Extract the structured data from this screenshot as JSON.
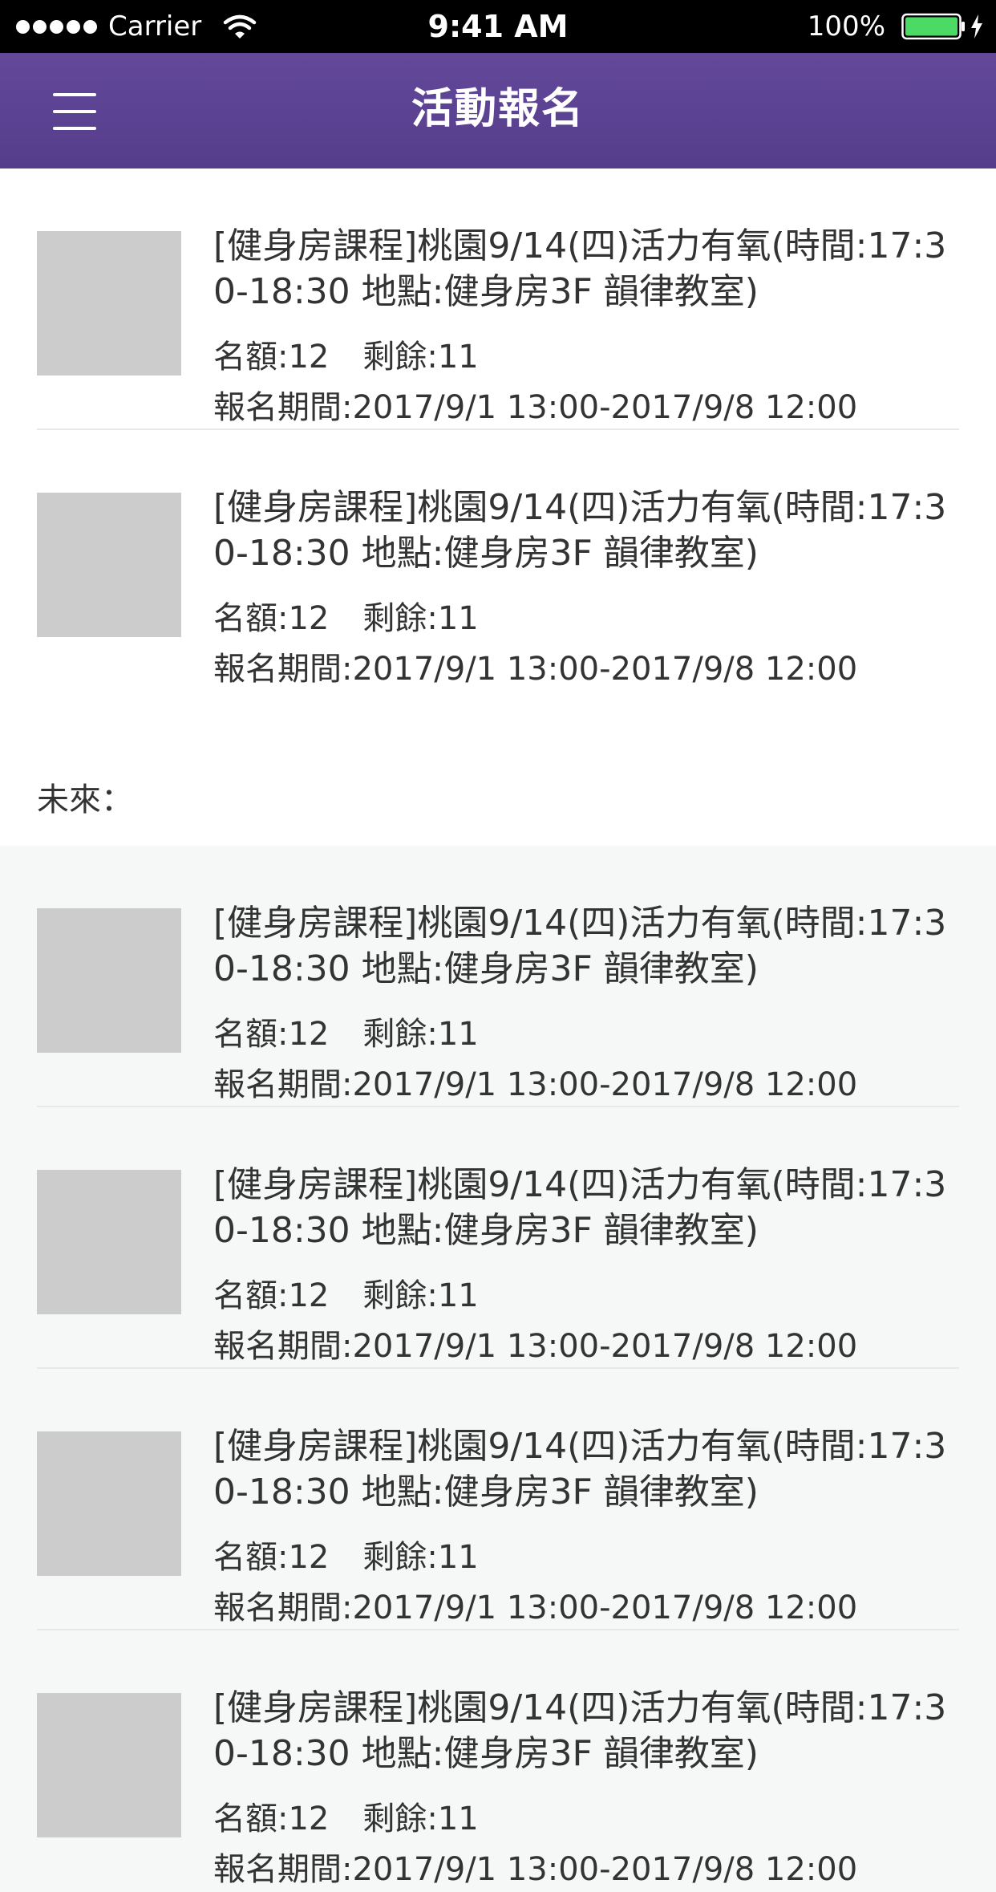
{
  "status_bar": {
    "carrier": "Carrier",
    "time": "9:41 AM",
    "battery": "100%",
    "icons": [
      "signal-dots-icon",
      "wifi-icon",
      "battery-icon",
      "charging-bolt-icon"
    ]
  },
  "nav": {
    "title": "活動報名",
    "menu_icon": "hamburger-menu-icon"
  },
  "sections": {
    "future_label": "未來："
  },
  "colors": {
    "nav_bar": "#5b4191",
    "thumbnail_placeholder": "#cccccc",
    "future_background": "#f6f7f7"
  },
  "current_events": [
    {
      "title": "[健身房課程]桃園9/14(四)活力有氧(時間:17:30-18:30 地點:健身房3F 韻律教室)",
      "quota": "名額:12",
      "remaining": "剩餘:11",
      "period": "報名期間:2017/9/1 13:00-2017/9/8 12:00"
    },
    {
      "title": "[健身房課程]桃園9/14(四)活力有氧(時間:17:30-18:30 地點:健身房3F 韻律教室)",
      "quota": "名額:12",
      "remaining": "剩餘:11",
      "period": "報名期間:2017/9/1 13:00-2017/9/8 12:00"
    }
  ],
  "future_events": [
    {
      "title": "[健身房課程]桃園9/14(四)活力有氧(時間:17:30-18:30 地點:健身房3F 韻律教室)",
      "quota": "名額:12",
      "remaining": "剩餘:11",
      "period": "報名期間:2017/9/1 13:00-2017/9/8 12:00"
    },
    {
      "title": "[健身房課程]桃園9/14(四)活力有氧(時間:17:30-18:30 地點:健身房3F 韻律教室)",
      "quota": "名額:12",
      "remaining": "剩餘:11",
      "period": "報名期間:2017/9/1 13:00-2017/9/8 12:00"
    },
    {
      "title": "[健身房課程]桃園9/14(四)活力有氧(時間:17:30-18:30 地點:健身房3F 韻律教室)",
      "quota": "名額:12",
      "remaining": "剩餘:11",
      "period": "報名期間:2017/9/1 13:00-2017/9/8 12:00"
    },
    {
      "title": "[健身房課程]桃園9/14(四)活力有氧(時間:17:30-18:30 地點:健身房3F 韻律教室)",
      "quota": "名額:12",
      "remaining": "剩餘:11",
      "period": "報名期間:2017/9/1 13:00-2017/9/8 12:00"
    }
  ]
}
